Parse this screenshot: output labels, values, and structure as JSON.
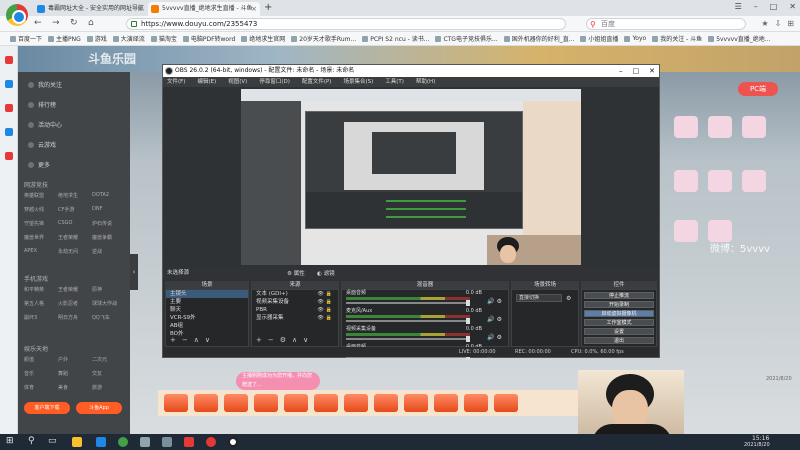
{
  "browser": {
    "tabs": [
      {
        "label": "毒霸网址大全 - 安全实用的网址导航",
        "active": false
      },
      {
        "label": "5vvvvv直播_绝地求生直播 - 斗鱼",
        "active": true
      }
    ],
    "tab_close": "×",
    "new_tab": "+",
    "url": "https://www.douyu.com/2355473",
    "search_placeholder": "百度",
    "bookmarks": [
      "百度一下",
      "主播PNG",
      "游戏",
      "大演绎流",
      "猫淘宝",
      "电脑PDF转word",
      "绝地求生官网",
      "20岁天才歌手Rum...",
      "PCPI S2 ncu - 读书...",
      "CTG电子竞技俱乐...",
      "国外机器你的好利_直...",
      "小姐姐直播",
      "Yoyo",
      "我的关注 - 斗鱼",
      "5vvvvv直播_绝地..."
    ],
    "nav": {
      "back": "←",
      "forward": "→",
      "refresh": "↻",
      "home": "⌂"
    }
  },
  "douyu": {
    "banner_text": "斗鱼乐园",
    "sidebar_items": [
      "我的关注",
      "排行榜",
      "活动中心",
      "云游戏",
      "更多"
    ],
    "section_live": "网游竞技",
    "grid_live": [
      "英雄联盟",
      "绝地求生",
      "DOTA2",
      "穿越火线",
      "CF手游",
      "DNF",
      "守望先锋",
      "CSGO",
      "炉石传说",
      "魔兽世界",
      "王者荣耀",
      "魔兽争霸",
      "APEX",
      "永劫无间",
      "逆战"
    ],
    "section_mobile": "手机游戏",
    "grid_mobile": [
      "和平精英",
      "王者荣耀",
      "原神",
      "第五人格",
      "火影忍者",
      "球球大作战",
      "崩坏3",
      "明日方舟",
      "QQ飞车"
    ],
    "section_ent": "娱乐天地",
    "grid_ent": [
      "颜值",
      "户外",
      "二次元",
      "音乐",
      "舞蹈",
      "交友",
      "体育",
      "美食",
      "旅游"
    ],
    "btn_download": "客户端下载",
    "btn_app": "斗鱼App",
    "pc_badge": "PC端",
    "watermark": "微博：5vvvv",
    "date": "2021/8/20",
    "toast": "主播刚刚成功为您开播，并向您赠送了...",
    "colors": {
      "accent": "#ff5d23",
      "sidebar": "#424548"
    }
  },
  "obs": {
    "title": "OBS 26.0.2 (64-bit, windows) - 配置文件: 未命名 - 场景: 未命名",
    "menu": [
      "文件(F)",
      "编辑(E)",
      "视图(V)",
      "停靠窗口(D)",
      "配置文件(P)",
      "场景集合(S)",
      "工具(T)",
      "帮助(H)"
    ],
    "window_controls": {
      "min": "–",
      "max": "□",
      "close": "✕"
    },
    "no_source": "未选择源",
    "properties_btn": "属性",
    "filters_btn": "滤镜",
    "scenes_header": "场景",
    "scenes": [
      "主镜头",
      "主要",
      "聊天",
      "VCR-S9外",
      "AB组",
      "BO外"
    ],
    "sources_header": "来源",
    "sources": [
      "文本 (GDI+)",
      "视频采集设备",
      "PBR",
      "显示器采集"
    ],
    "mixer_header": "混音器",
    "mixer_tracks": [
      {
        "name": "桌面音频",
        "db": "0.0 dB"
      },
      {
        "name": "麦克风/Aux",
        "db": "0.0 dB"
      },
      {
        "name": "视频采集设备",
        "db": "0.0 dB"
      },
      {
        "name": "桌面音频",
        "db": "0.0 dB"
      }
    ],
    "transition_header": "场景转场",
    "transition_value": "直接切换",
    "controls_header": "控件",
    "controls": [
      "停止推流",
      "开始录制",
      "启动虚拟摄像机",
      "工作室模式",
      "设置",
      "退出"
    ],
    "status": {
      "live": "LIVE: 00:00:00",
      "rec": "REC: 00:00:00",
      "cpu": "CPU: 0.0%, 60.00 fps"
    }
  },
  "taskbar": {
    "time": "15:16",
    "date": "2021/8/20"
  }
}
